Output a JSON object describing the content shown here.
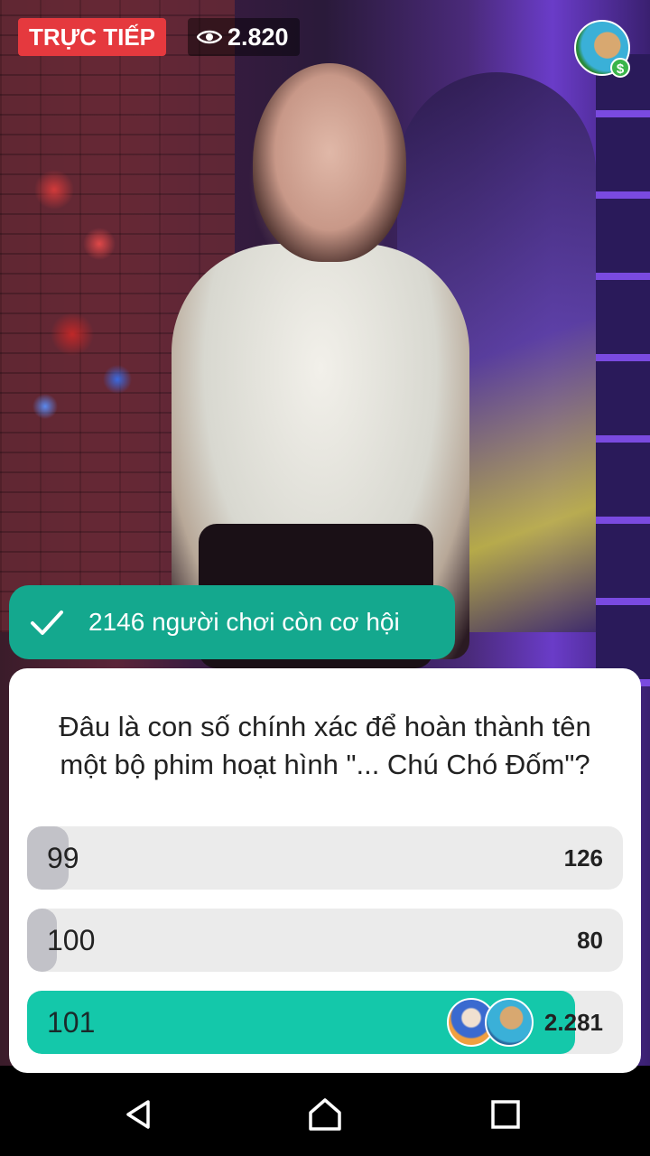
{
  "header": {
    "live_label": "TRỰC TIẾP",
    "viewer_count": "2.820",
    "viewer_icon": "eye-icon"
  },
  "status": {
    "icon": "check-icon",
    "text": "2146 người chơi còn cơ hội"
  },
  "quiz": {
    "question": "Đâu là con số chính xác để hoàn thành tên một bộ phim hoạt hình \"... Chú Chó Đốm\"?",
    "options": [
      {
        "label": "99",
        "count": "126",
        "share": 0.07
      },
      {
        "label": "100",
        "count": "80",
        "share": 0.05
      },
      {
        "label": "101",
        "count": "2.281",
        "share": 0.92
      }
    ]
  },
  "colors": {
    "live": "#e5393e",
    "accent": "#14a88e",
    "correct_fill": "#14c8aa"
  }
}
